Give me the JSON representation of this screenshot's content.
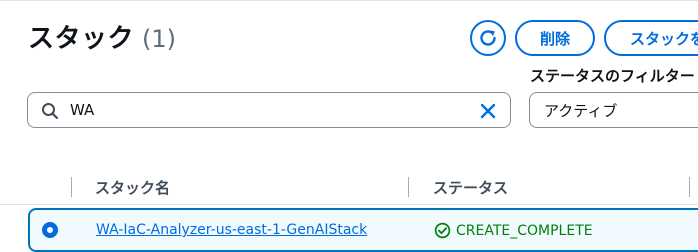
{
  "header": {
    "title": "スタック",
    "count": "(1)"
  },
  "actions": {
    "refresh_icon": "refresh-icon",
    "delete_label": "削除",
    "create_label": "スタックを"
  },
  "filter": {
    "status_label": "ステータスのフィルター",
    "status_value": "アクティブ"
  },
  "search": {
    "value": "WA"
  },
  "table": {
    "columns": [
      "スタック名",
      "ステータス"
    ],
    "rows": [
      {
        "name": "WA-IaC-Analyzer-us-east-1-GenAIStack",
        "status": "CREATE_COMPLETE",
        "selected": true
      }
    ]
  },
  "colors": {
    "accent": "#006ce0",
    "success": "#037f0c",
    "selected_row_bg": "#f1faff"
  }
}
